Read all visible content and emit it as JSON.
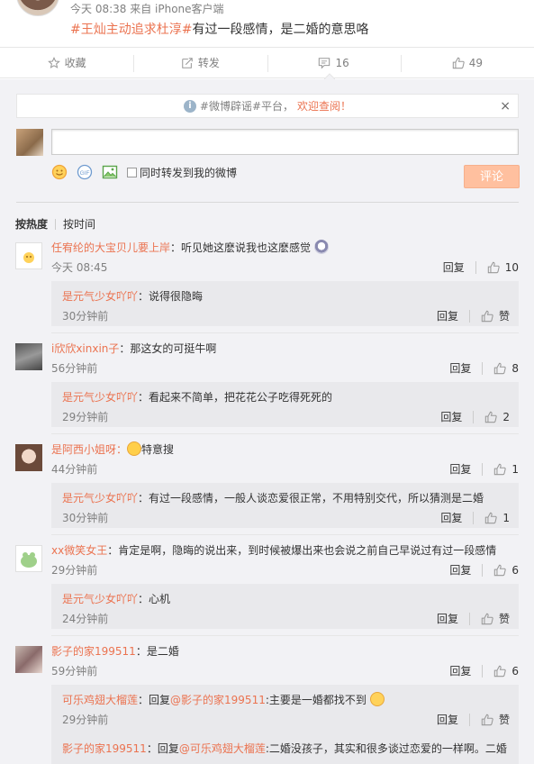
{
  "post": {
    "meta": "今天 08:38 来自 iPhone客户端",
    "topic": "#王灿主动追求杜淳#",
    "text": "有过一段感情，是二婚的意思咯"
  },
  "actions": {
    "favorite": "收藏",
    "repost": "转发",
    "comment_count": "16",
    "like_count": "49"
  },
  "notice": {
    "text": "#微博辟谣#平台，",
    "highlight": "欢迎查阅！",
    "close": "×"
  },
  "composer": {
    "placeholder": "",
    "also_repost": "同时转发到我的微博",
    "submit": "评论"
  },
  "sort": {
    "by_hot": "按热度",
    "by_time": "按时间"
  },
  "labels": {
    "reply": "回复",
    "like": "赞"
  },
  "comments": [
    {
      "name": "任宥纶的大宝贝儿要上岸",
      "text": "：听见她这麽说我也这麽感觉",
      "time": "今天 08:45",
      "likes": "10",
      "reply": {
        "name": "是元气少女吖吖",
        "text": "：说得很隐晦",
        "time": "30分钟前",
        "likes": "赞"
      }
    },
    {
      "name": "i欣欣xinxin子",
      "text": "：那这女的可挺牛啊",
      "time": "56分钟前",
      "likes": "8",
      "reply": {
        "name": "是元气少女吖吖",
        "text": "：看起来不简单，把花花公子吃得死死的",
        "time": "29分钟前",
        "likes": "2"
      }
    },
    {
      "name": "是阿西小姐呀",
      "text": "特意搜",
      "time": "44分钟前",
      "likes": "1",
      "reply": {
        "name": "是元气少女吖吖",
        "text": "：有过一段感情，一般人谈恋爱很正常，不用特别交代，所以猜测是二婚",
        "time": "30分钟前",
        "likes": "1"
      }
    },
    {
      "name": "xx微笑女王",
      "text": "：肯定是啊，隐晦的说出来，到时候被爆出来也会说之前自己早说过有过一段感情",
      "time": "29分钟前",
      "likes": "6",
      "reply": {
        "name": "是元气少女吖吖",
        "text": "：心机",
        "time": "24分钟前",
        "likes": "赞"
      }
    },
    {
      "name": "影子的家199511",
      "text": "：是二婚",
      "time": "59分钟前",
      "likes": "6",
      "reply": {
        "name": "可乐鸡翅大榴莲",
        "text_pre": "：回复",
        "mention": "@影子的家199511",
        "text": ":主要是一婚都找不到",
        "time": "29分钟前",
        "likes": "赞"
      },
      "reply2": {
        "name": "影子的家199511",
        "text_pre": "：回复",
        "mention": "@可乐鸡翅大榴莲",
        "text": ":二婚没孩子，其实和很多谈过恋爱的一样啊。二婚"
      }
    }
  ],
  "colors": {
    "accent": "#eb7350",
    "panel_bg": "#f2f2f5",
    "reply_bg": "#e9e9ec",
    "submit_bg": "#ffc09f"
  }
}
